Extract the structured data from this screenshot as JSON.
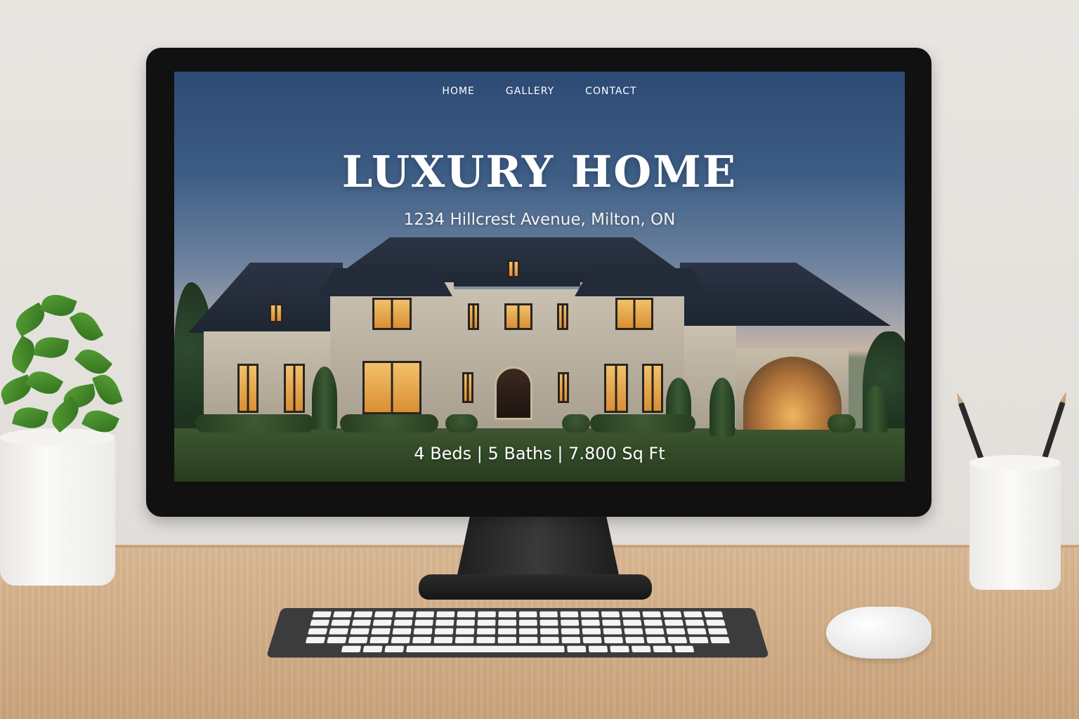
{
  "nav": {
    "items": [
      {
        "label": "HOME"
      },
      {
        "label": "GALLERY"
      },
      {
        "label": "CONTACT"
      }
    ]
  },
  "hero": {
    "title": "LUXURY HOME",
    "address": "1234 Hillcrest Avenue, Milton, ON",
    "specs": "4 Beds | 5 Baths | 7.800 Sq Ft"
  },
  "colors": {
    "sky_top": "#2d4a75",
    "text": "#ffffff",
    "monitor_bezel": "#111111",
    "desk": "#d3b08b"
  },
  "icons": [
    "house-photo",
    "plant-icon",
    "pencil-cup-icon",
    "keyboard-icon",
    "mouse-icon"
  ]
}
